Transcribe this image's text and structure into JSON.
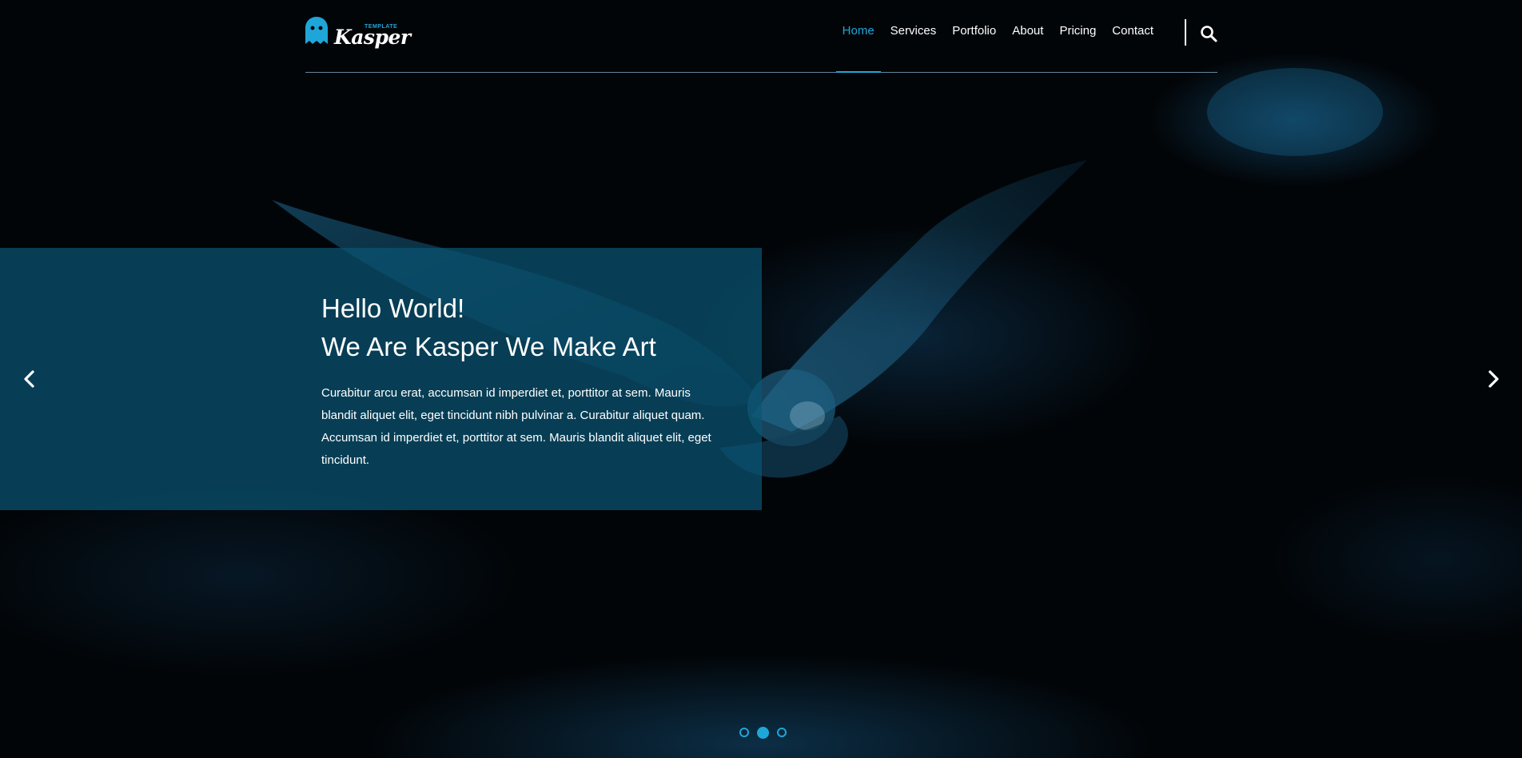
{
  "brand": {
    "name": "Kasper",
    "tag": "TEMPLATE",
    "accent_color": "#1fa6d9"
  },
  "nav": {
    "items": [
      {
        "label": "Home",
        "active": true
      },
      {
        "label": "Services",
        "active": false
      },
      {
        "label": "Portfolio",
        "active": false
      },
      {
        "label": "About",
        "active": false
      },
      {
        "label": "Pricing",
        "active": false
      },
      {
        "label": "Contact",
        "active": false
      }
    ],
    "search_icon": "search-icon"
  },
  "hero": {
    "headline_line1": "Hello World!",
    "headline_line2": "We Are Kasper We Make Art",
    "description": "Curabitur arcu erat, accumsan id imperdiet et, porttitor at sem. Mauris blandit aliquet elit, eget tincidunt nibh pulvinar a. Curabitur aliquet quam. Accumsan id imperdiet et, porttitor at sem. Mauris blandit aliquet elit, eget tincidunt.",
    "box_color": "#0a5573",
    "prev_icon": "chevron-left-icon",
    "next_icon": "chevron-right-icon"
  },
  "slider": {
    "total": 3,
    "active_index": 1
  }
}
